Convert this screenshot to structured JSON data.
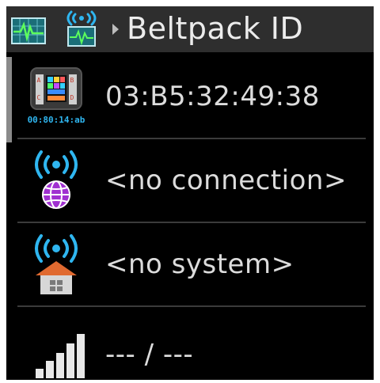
{
  "header": {
    "title": "Beltpack ID",
    "icons": [
      "signal-monitor-icon",
      "wireless-monitor-icon",
      "chevron-right-icon"
    ]
  },
  "rows": [
    {
      "icon": "beltpack-device-icon",
      "icon_caption": "00:80:14:ab",
      "value": "03:B5:32:49:38"
    },
    {
      "icon": "wireless-globe-icon",
      "value": "<no connection>"
    },
    {
      "icon": "wireless-home-icon",
      "value": "<no system>"
    },
    {
      "icon": "signal-strength-icon",
      "value": "--- / ---"
    }
  ],
  "colors": {
    "background": "#000000",
    "header": "#2e2e2e",
    "text": "#dcdcdc",
    "wireless_blue": "#2fb6f0",
    "globe_purple": "#a030d0",
    "roof_orange": "#e06a30"
  }
}
